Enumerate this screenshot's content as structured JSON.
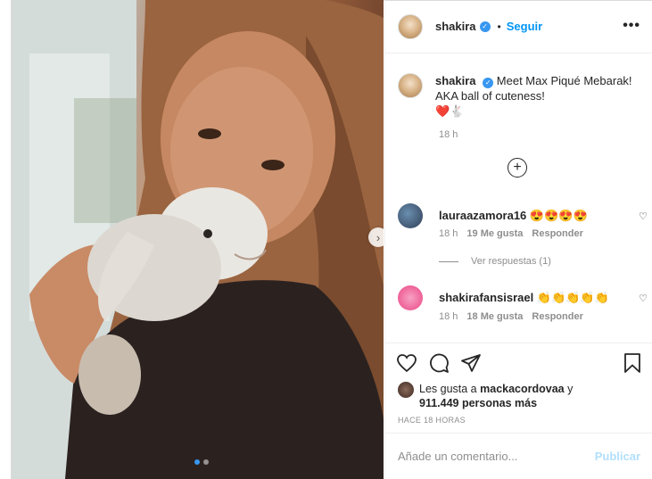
{
  "post": {
    "username": "shakira",
    "follow_label": "Seguir",
    "more_label": "•••",
    "caption_text": "Meet Max Piqué Mebarak! AKA ball of cuteness!",
    "caption_emojis": "❤️🐇",
    "caption_time": "18 h",
    "load_more_icon": "plus-circle-icon",
    "load_more_symbol": "+",
    "carousel_next_symbol": "›"
  },
  "comments": [
    {
      "username": "lauraazamora16",
      "text": "😍😍😍😍",
      "time": "18 h",
      "likes": "19 Me gusta",
      "reply": "Responder"
    },
    {
      "username": "shakirafansisrael",
      "text": "👏👏👏👏👏",
      "time": "18 h",
      "likes": "18 Me gusta",
      "reply": "Responder"
    }
  ],
  "view_replies": "Ver respuestas (1)",
  "heart_outline": "♡",
  "likes_line": {
    "prefix": "Les gusta a",
    "user": "mackacordovaa",
    "connector": "y",
    "count": "911.449 personas más"
  },
  "posted_ago": "HACE 18 HORAS",
  "add_comment": {
    "placeholder": "Añade un comentario...",
    "post_label": "Publicar"
  },
  "colors": {
    "accent": "#0095f6",
    "verified": "#3897f0",
    "muted": "#8e8e8e",
    "post_disabled": "#b2dffc"
  },
  "carousel": {
    "slides": 2,
    "active": 1
  }
}
